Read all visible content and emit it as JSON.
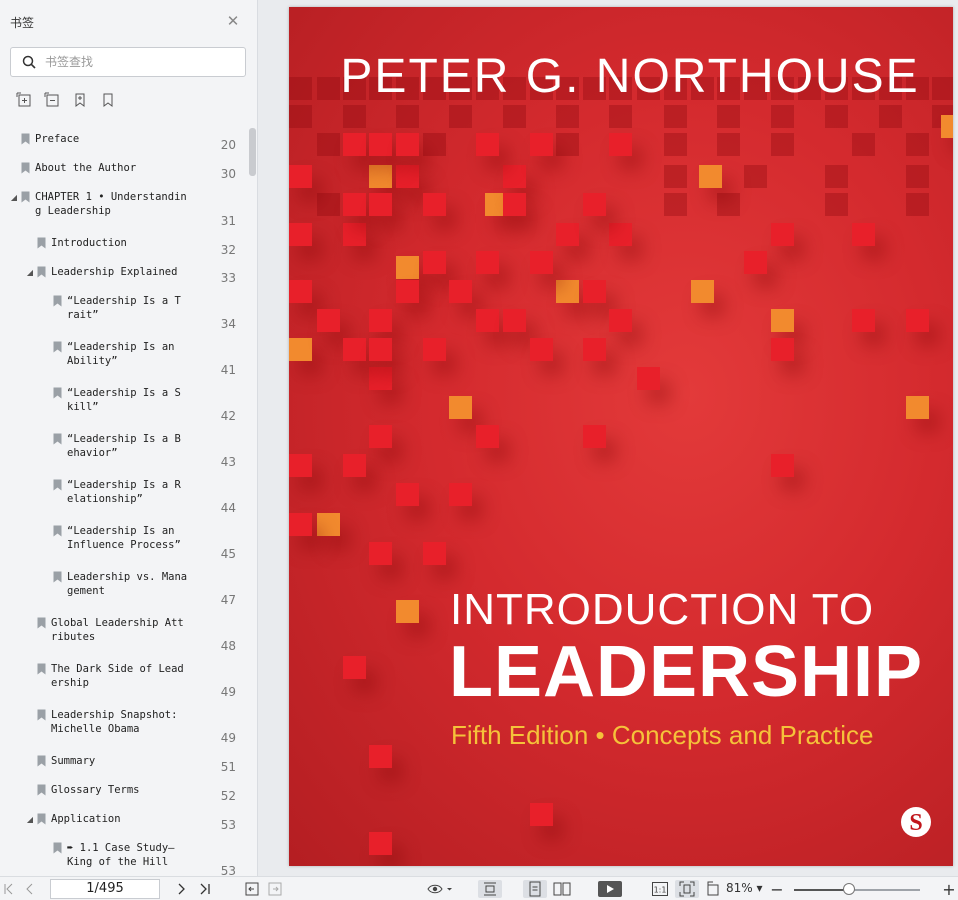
{
  "sidebar": {
    "title": "书签",
    "search_placeholder": "书签查找",
    "toc": [
      {
        "label": "Preface",
        "page": "20",
        "level": 0,
        "arrow": ""
      },
      {
        "label": "About the Author",
        "page": "30",
        "level": 0,
        "arrow": ""
      },
      {
        "label": "CHAPTER 1 • Understandin\ng Leadership",
        "page": "31",
        "level": 0,
        "arrow": "down"
      },
      {
        "label": "Introduction",
        "page": "32",
        "level": 1,
        "arrow": ""
      },
      {
        "label": "Leadership Explained",
        "page": "33",
        "level": 1,
        "arrow": "down"
      },
      {
        "label": "“Leadership Is a T\nrait”",
        "page": "34",
        "level": 2,
        "arrow": ""
      },
      {
        "label": "“Leadership Is an\nAbility”",
        "page": "41",
        "level": 2,
        "arrow": ""
      },
      {
        "label": "“Leadership Is a S\nkill”",
        "page": "42",
        "level": 2,
        "arrow": ""
      },
      {
        "label": "“Leadership Is a B\nehavior”",
        "page": "43",
        "level": 2,
        "arrow": ""
      },
      {
        "label": "“Leadership Is a R\nelationship”",
        "page": "44",
        "level": 2,
        "arrow": ""
      },
      {
        "label": "“Leadership Is an\nInfluence Process”",
        "page": "45",
        "level": 2,
        "arrow": ""
      },
      {
        "label": "Leadership vs. Mana\ngement",
        "page": "47",
        "level": 2,
        "arrow": ""
      },
      {
        "label": "Global Leadership Att\nributes",
        "page": "48",
        "level": 1,
        "arrow": ""
      },
      {
        "label": "The Dark Side of Lead\nership",
        "page": "49",
        "level": 1,
        "arrow": ""
      },
      {
        "label": "Leadership Snapshot:\nMichelle Obama",
        "page": "49",
        "level": 1,
        "arrow": ""
      },
      {
        "label": "Summary",
        "page": "51",
        "level": 1,
        "arrow": ""
      },
      {
        "label": "Glossary Terms",
        "page": "52",
        "level": 1,
        "arrow": ""
      },
      {
        "label": "Application",
        "page": "53",
        "level": 1,
        "arrow": "down"
      },
      {
        "label": "➨ 1.1 Case Study—\nKing of the Hill",
        "page": "53",
        "level": 2,
        "arrow": ""
      }
    ]
  },
  "cover": {
    "author": "PETER G. NORTHOUSE",
    "title_line1": "INTRODUCTION TO",
    "title_line2": "LEADERSHIP",
    "edition": "Fifth Edition • Concepts and Practice",
    "publisher_logo": "S",
    "colors": {
      "background": "#d42a2e",
      "edition": "#f5c23a",
      "square_red": "#e8202a",
      "square_orange": "#f28a2e"
    }
  },
  "toolbar": {
    "page_indicator": "1/495",
    "zoom": "81%",
    "zoom_level": 0.44
  }
}
